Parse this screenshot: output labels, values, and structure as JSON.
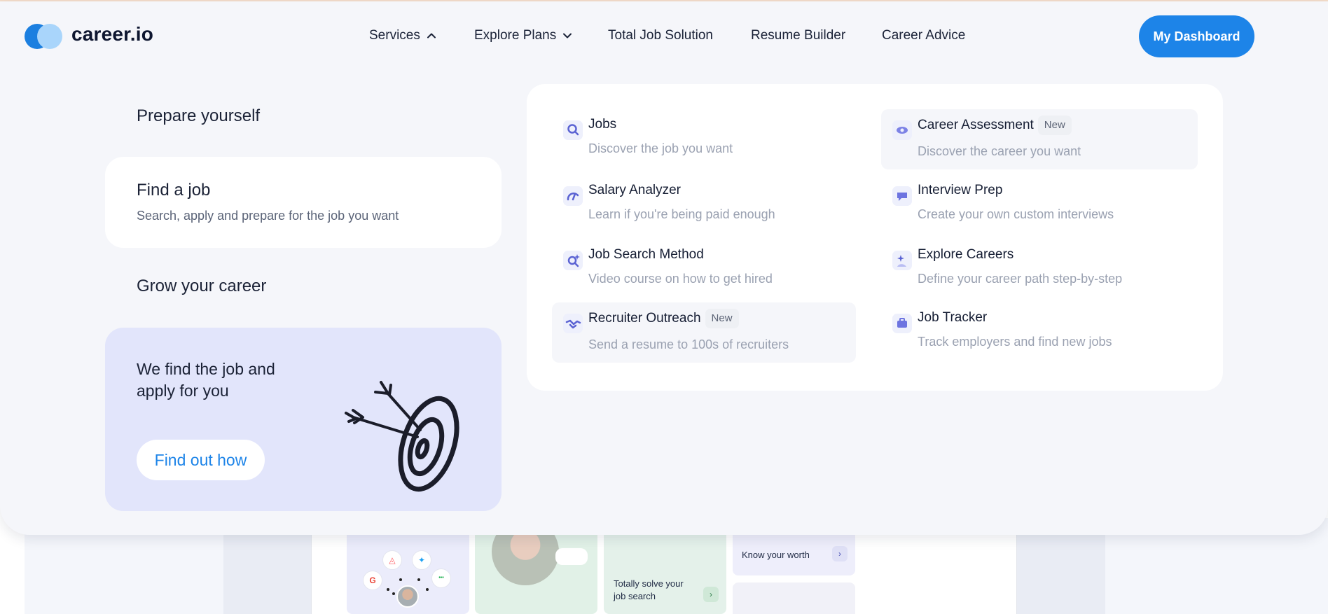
{
  "header": {
    "brand": "career.io",
    "nav": [
      {
        "label": "Services",
        "icon": "chevron-up-icon"
      },
      {
        "label": "Explore Plans",
        "icon": "chevron-down-icon"
      },
      {
        "label": "Total Job Solution"
      },
      {
        "label": "Resume Builder"
      },
      {
        "label": "Career Advice"
      }
    ],
    "dashboard_label": "My Dashboard"
  },
  "menu": {
    "prepare_title": "Prepare yourself",
    "find_job": {
      "title": "Find a job",
      "subtitle": "Search, apply and prepare for the job you want"
    },
    "grow_title": "Grow your career",
    "promo": {
      "title": "We find the job and apply for you",
      "button": "Find out how"
    },
    "services": [
      {
        "title": "Jobs",
        "desc": "Discover the job you want",
        "icon": "search-icon"
      },
      {
        "title": "Career Assessment",
        "badge": "New",
        "desc": "Discover the career you want",
        "icon": "eye-icon"
      },
      {
        "title": "Salary Analyzer",
        "desc": "Learn if you're being paid enough",
        "icon": "gauge-icon"
      },
      {
        "title": "Interview Prep",
        "desc": "Create your own custom interviews",
        "icon": "chat-icon"
      },
      {
        "title": "Job Search Method",
        "desc": "Video course on how to get hired",
        "icon": "search-sparkle-icon"
      },
      {
        "title": "Explore Careers",
        "desc": "Define your career path step-by-step",
        "icon": "person-sparkle-icon"
      },
      {
        "title": "Recruiter Outreach",
        "badge": "New",
        "desc": "Send a resume to 100s of recruiters",
        "icon": "handshake-icon"
      },
      {
        "title": "Job Tracker",
        "desc": "Track employers and find new jobs",
        "icon": "briefcase-icon"
      }
    ]
  },
  "background_cards": {
    "card4_text": "Know your worth",
    "card3_text": "Totally solve your job search"
  },
  "colors": {
    "accent": "#1d84e8",
    "panel_bg": "#f5f6fa",
    "promo_bg": "#e2e5fb"
  }
}
